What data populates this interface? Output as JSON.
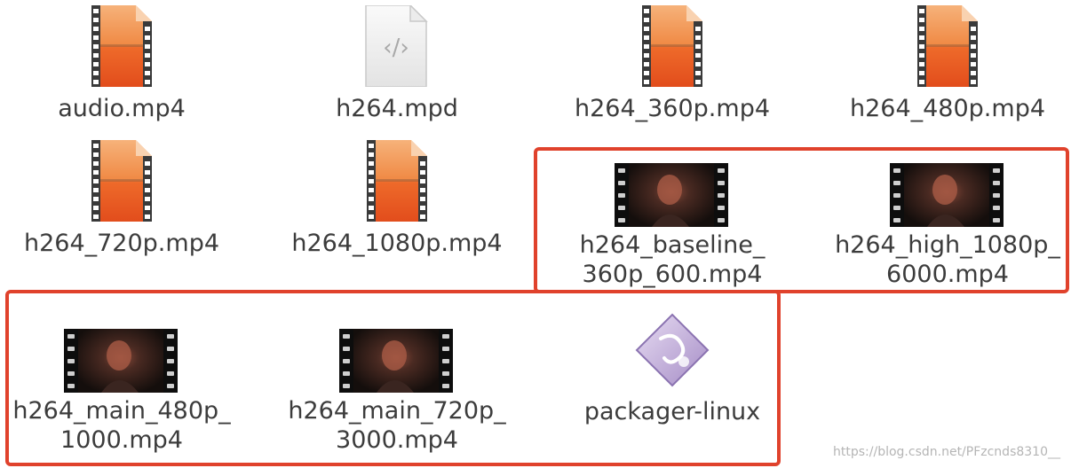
{
  "files": [
    {
      "name": "audio.mp4",
      "type": "video-doc"
    },
    {
      "name": "h264.mpd",
      "type": "xml-doc"
    },
    {
      "name": "h264_360p.mp4",
      "type": "video-doc"
    },
    {
      "name": "h264_480p.mp4",
      "type": "video-doc"
    },
    {
      "name": "h264_720p.mp4",
      "type": "video-doc"
    },
    {
      "name": "h264_1080p.mp4",
      "type": "video-doc"
    },
    {
      "name_line1": "h264_baseline_",
      "name_line2": "360p_600.mp4",
      "type": "video-thumb"
    },
    {
      "name_line1": "h264_high_1080p_",
      "name_line2": "6000.mp4",
      "type": "video-thumb"
    },
    {
      "name_line1": "h264_main_480p_",
      "name_line2": "1000.mp4",
      "type": "video-thumb"
    },
    {
      "name_line1": "h264_main_720p_",
      "name_line2": "3000.mp4",
      "type": "video-thumb"
    },
    {
      "name": "packager-linux",
      "type": "executable"
    }
  ],
  "colors": {
    "highlight_border": "#e0422c",
    "video_orange": "#f07030",
    "film_strip": "#3a3a3a"
  },
  "watermark": "https://blog.csdn.net/PFzcnds8310__"
}
